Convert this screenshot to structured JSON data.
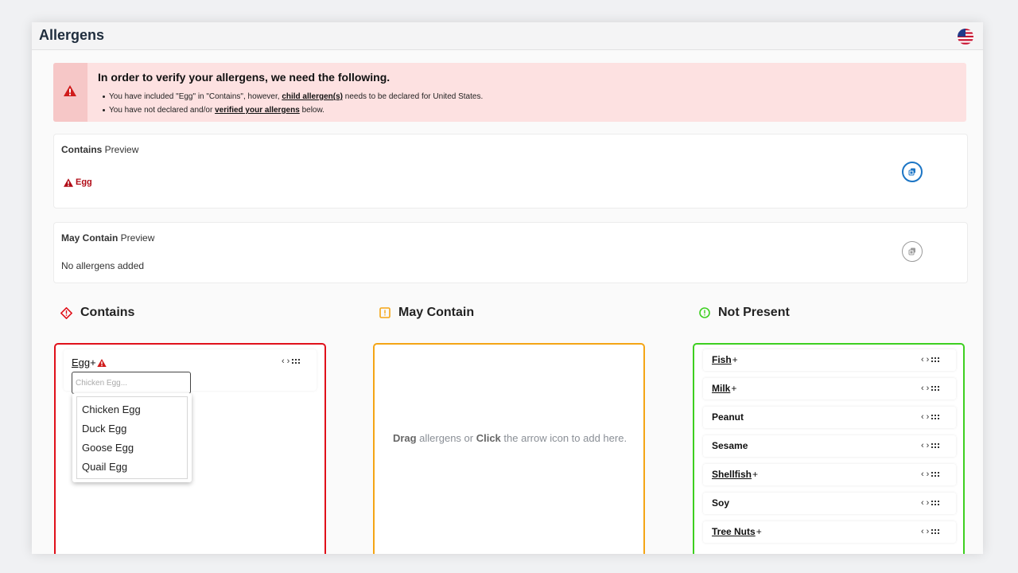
{
  "header": {
    "title": "Allergens",
    "flag_icon": "us-flag-icon"
  },
  "alert": {
    "title": "In order to verify your allergens, we need the following.",
    "line1_prefix": "You have included \"Egg\" in \"Contains\", however, ",
    "line1_link": "child allergen(s)",
    "line1_suffix": " needs to be declared for United States.",
    "line2_prefix": "You have not declared and/or ",
    "line2_link": "verified your allergens",
    "line2_suffix": " below.",
    "color_bg": "#fde1e1",
    "color_side": "#f6c7c7",
    "color_icon": "#d01b1b"
  },
  "contains_preview": {
    "label_bold": "Contains",
    "label_rest": " Preview",
    "value": "Egg",
    "value_color": "#b10b16",
    "button_color": "#1c75c5"
  },
  "may_contain_preview": {
    "label_bold": "May Contain",
    "label_rest": " Preview",
    "value": "No allergens added",
    "button_color": "#9a9a9a"
  },
  "columns": {
    "contains": {
      "title": "Contains",
      "color": "#e0101a",
      "item": {
        "name": "Egg",
        "plus": "+",
        "input_placeholder": "Chicken Egg...",
        "options": [
          "Chicken Egg",
          "Duck Egg",
          "Goose Egg",
          "Quail Egg"
        ]
      }
    },
    "may_contain": {
      "title": "May Contain",
      "color": "#f4a515",
      "empty_drag": "Drag",
      "empty_mid": " allergens or ",
      "empty_click": "Click",
      "empty_end": " the arrow icon to add here."
    },
    "not_present": {
      "title": "Not Present",
      "color": "#3dcf20",
      "items": [
        {
          "name": "Fish",
          "plus": "+"
        },
        {
          "name": "Milk",
          "plus": "+"
        },
        {
          "name": "Peanut",
          "plus": ""
        },
        {
          "name": "Sesame",
          "plus": ""
        },
        {
          "name": "Shellfish",
          "plus": "+"
        },
        {
          "name": "Soy",
          "plus": ""
        },
        {
          "name": "Tree Nuts",
          "plus": "+"
        }
      ]
    }
  },
  "controls": {
    "left": "‹",
    "right": "›"
  }
}
